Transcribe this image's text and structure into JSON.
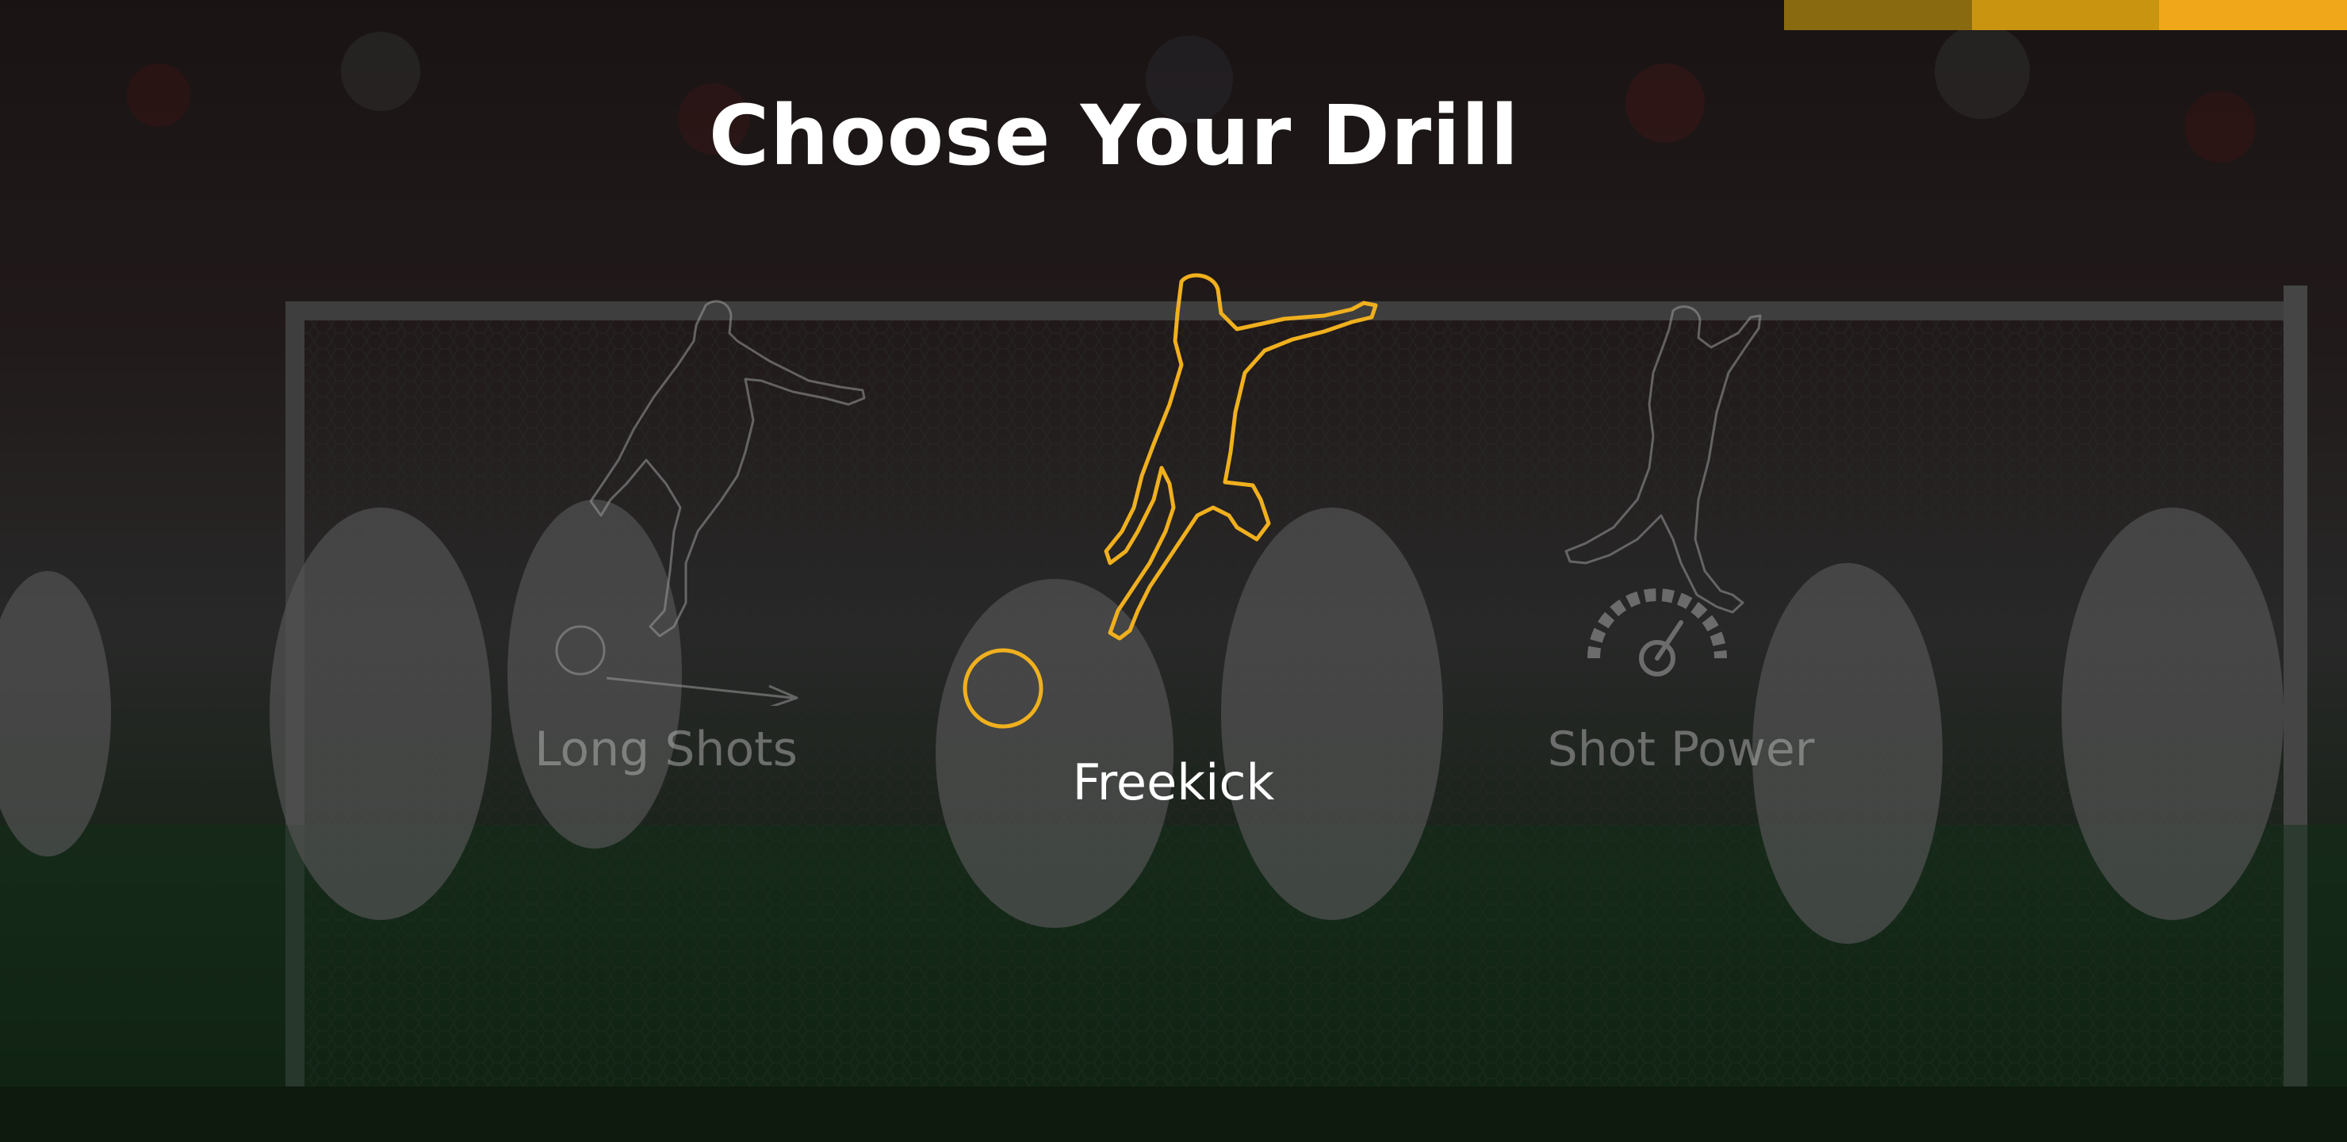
{
  "screen": {
    "title": "Choose Your Drill"
  },
  "progress": {
    "segments": [
      {
        "color": "#8a6a10"
      },
      {
        "color": "#c99410"
      },
      {
        "color": "#f0a81a"
      }
    ]
  },
  "drills": [
    {
      "label": "Long Shots",
      "selected": false,
      "icon": "long-shot-player-icon"
    },
    {
      "label": "Freekick",
      "selected": true,
      "icon": "freekick-player-icon"
    },
    {
      "label": "Shot Power",
      "selected": false,
      "icon": "shot-power-gauge-icon"
    }
  ],
  "colors": {
    "accent": "#f0b01e",
    "inactive": "#9a9a9a",
    "label_active": "#ffffff"
  }
}
